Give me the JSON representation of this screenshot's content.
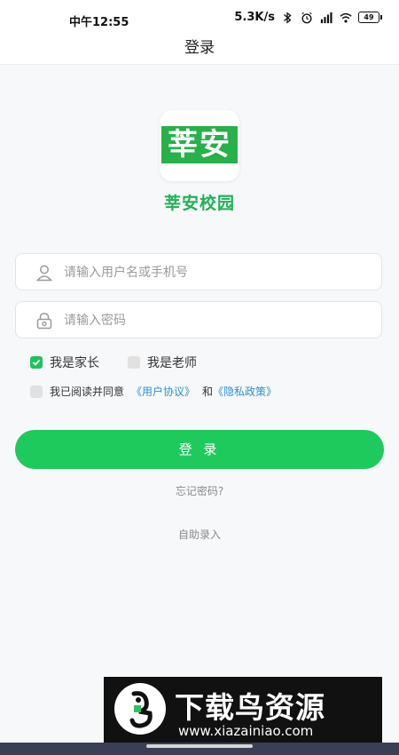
{
  "status_bar": {
    "time": "中午12:55",
    "network_speed": "5.3K/s",
    "battery_level": "49",
    "icons": [
      "bluetooth-icon",
      "alarm-icon",
      "signal-icon",
      "wifi-icon",
      "battery-icon"
    ]
  },
  "header": {
    "title": "登录"
  },
  "logo": {
    "text": "莘安",
    "brand_color": "#26b14a"
  },
  "app_name": "莘安校园",
  "form": {
    "username": {
      "placeholder": "请输入用户名或手机号",
      "value": ""
    },
    "password": {
      "placeholder": "请输入密码",
      "value": ""
    }
  },
  "roles": [
    {
      "label": "我是家长",
      "checked": true
    },
    {
      "label": "我是老师",
      "checked": false
    }
  ],
  "agreement": {
    "checked": false,
    "prefix": "我已阅读并同意",
    "user_agreement": "《用户协议》",
    "conjunction": "和",
    "privacy_policy": "《隐私政策》"
  },
  "login_button": {
    "label": "登 录",
    "color": "#1fca5d"
  },
  "forgot_password": "忘记密码?",
  "self_entry": "自助录入",
  "watermark": {
    "title": "下载鸟资源",
    "url": "www.xiazainiao.com"
  }
}
